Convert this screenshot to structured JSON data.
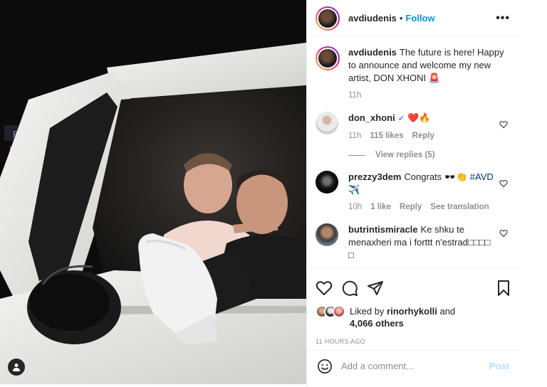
{
  "post": {
    "photo_alt": "",
    "header": {
      "username": "avdiudenis",
      "dot": "•",
      "follow_label": "Follow",
      "more_label": "•••"
    },
    "caption": {
      "username": "avdiudenis",
      "text": "The future is here! Happy to announce and welcome my new artist, DON XHONI 🚨",
      "time": "11h"
    },
    "comments": [
      {
        "username": "don_xhoni",
        "text": "❤️🔥",
        "time": "11h",
        "likes": "115 likes",
        "reply": "Reply",
        "view_replies": "View replies (5)"
      },
      {
        "username": "prezzy3dem",
        "text": "Congrats 🕶️👏",
        "hashtag": "#AVD",
        "text2": "✈️",
        "time": "10h",
        "likes": "1 like",
        "reply": "Reply",
        "translate": "See translation"
      },
      {
        "username": "butrintismiracle",
        "text": "Ke shku te menaxheri ma i forttt n'estrad□□□□ □"
      }
    ],
    "liked_by": {
      "prefix": "Liked by",
      "user": "rinorhykolli",
      "and": "and",
      "others": "4,066 others"
    },
    "timestamp": "11 HOURS AGO",
    "add_comment": {
      "placeholder": "Add a comment...",
      "post_label": "Post"
    },
    "icons": [
      "heart-icon",
      "comment-icon",
      "share-icon",
      "bookmark-icon",
      "emoji-icon",
      "user-tag-icon"
    ],
    "colors": {
      "link_blue": "#0095f6",
      "muted": "#8e8e8e",
      "border": "#efefef",
      "post_disabled": "#b2dffc"
    }
  }
}
